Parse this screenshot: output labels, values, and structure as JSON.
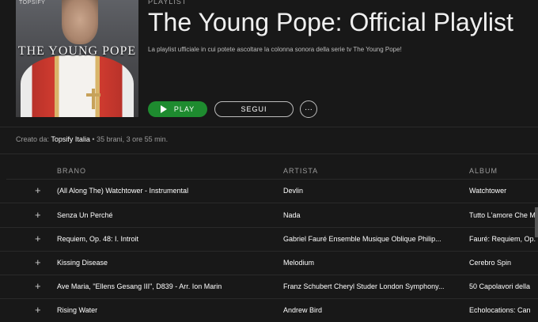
{
  "cover": {
    "brand": "TOPSIFY",
    "cover_title": "THE YOUNG POPE"
  },
  "header": {
    "kind": "PLAYLIST",
    "title": "The Young Pope: Official Playlist",
    "description": "La playlist ufficiale in cui potete ascoltare la colonna sonora della serie tv The Young Pope!"
  },
  "actions": {
    "play_label": "PLAY",
    "follow_label": "SEGUI",
    "more_label": "···"
  },
  "meta": {
    "created_prefix": "Creato da: ",
    "owner": "Topsify Italia",
    "stats": " • 35 brani, 3 ore 55 min."
  },
  "columns": {
    "song": "BRANO",
    "artist": "ARTISTA",
    "album": "ALBUM"
  },
  "tracks": [
    {
      "song": "(All Along The) Watchtower - Instrumental",
      "artist": "Devlin",
      "album": "Watchtower"
    },
    {
      "song": "Senza Un Perché",
      "artist": "Nada",
      "album": "Tutto L'amore Che Mi"
    },
    {
      "song": "Requiem, Op. 48: I. Introit",
      "artist": "Gabriel Fauré Ensemble Musique Oblique Philip...",
      "album": "Fauré: Requiem, Op."
    },
    {
      "song": "Kissing Disease",
      "artist": "Melodium",
      "album": "Cerebro Spin"
    },
    {
      "song": "Ave Maria, \"Ellens Gesang III\", D839 - Arr. Ion Marin",
      "artist": "Franz Schubert Cheryl Studer London Symphony...",
      "album": "50 Capolavori della"
    },
    {
      "song": "Rising Water",
      "artist": "Andrew Bird",
      "album": "Echolocations: Can"
    }
  ],
  "icons": {
    "add": "plus-icon",
    "play": "play-icon"
  },
  "colors": {
    "background": "#181818",
    "accent": "#1e8b2f",
    "text": "#ffffff",
    "muted": "#9b9b9b"
  }
}
